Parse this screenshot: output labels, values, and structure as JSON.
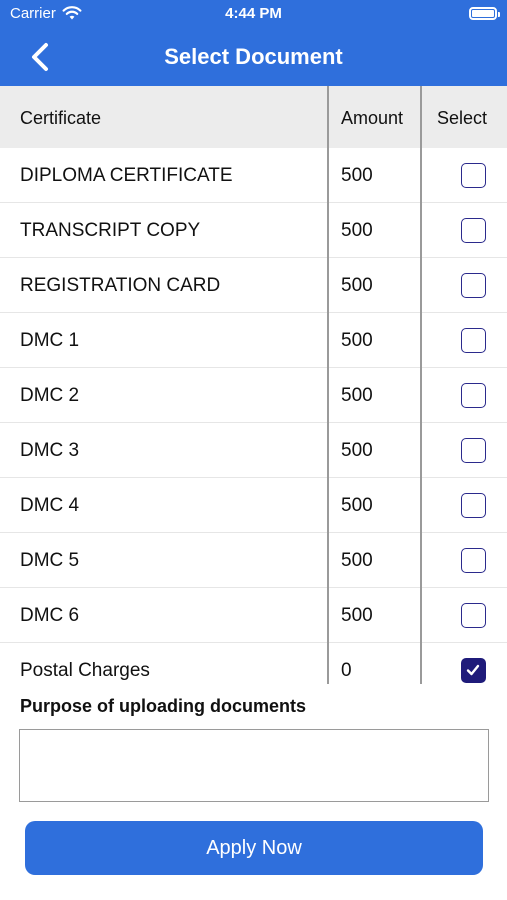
{
  "status": {
    "carrier": "Carrier",
    "time": "4:44 PM"
  },
  "nav": {
    "title": "Select Document"
  },
  "table": {
    "headers": {
      "certificate": "Certificate",
      "amount": "Amount",
      "select": "Select"
    },
    "rows": [
      {
        "name": "DIPLOMA CERTIFICATE",
        "amount": "500",
        "selected": false
      },
      {
        "name": "TRANSCRIPT COPY",
        "amount": "500",
        "selected": false
      },
      {
        "name": "REGISTRATION CARD",
        "amount": "500",
        "selected": false
      },
      {
        "name": "DMC 1",
        "amount": "500",
        "selected": false
      },
      {
        "name": "DMC 2",
        "amount": "500",
        "selected": false
      },
      {
        "name": "DMC 3",
        "amount": "500",
        "selected": false
      },
      {
        "name": "DMC 4",
        "amount": "500",
        "selected": false
      },
      {
        "name": "DMC 5",
        "amount": "500",
        "selected": false
      },
      {
        "name": "DMC 6",
        "amount": "500",
        "selected": false
      },
      {
        "name": "Postal Charges",
        "amount": "0",
        "selected": true
      }
    ]
  },
  "purpose": {
    "label": "Purpose of uploading documents",
    "value": "",
    "placeholder": ""
  },
  "apply_label": "Apply Now",
  "colors": {
    "accent": "#2f6fdc",
    "checkbox": "#1f1b7a"
  },
  "icons": {
    "back": "chevron-left-icon",
    "wifi": "wifi-icon",
    "battery": "battery-icon",
    "check": "checkmark-icon"
  }
}
